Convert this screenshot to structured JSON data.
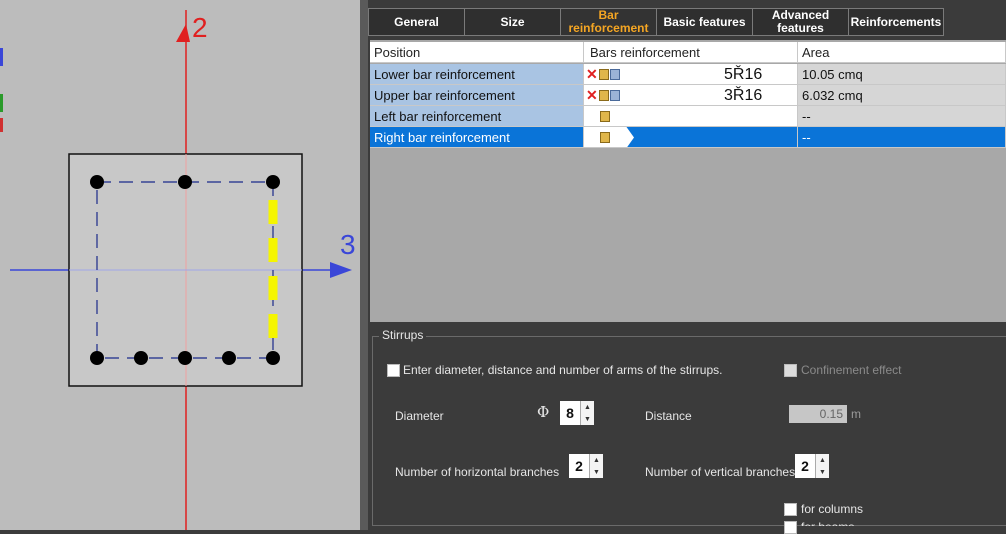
{
  "tabs": [
    {
      "label": "General",
      "active": false
    },
    {
      "label": "Size",
      "active": false
    },
    {
      "label": "Bar reinforcement",
      "active": true
    },
    {
      "label": "Basic features",
      "active": false
    },
    {
      "label": "Advanced features",
      "active": false
    },
    {
      "label": "Reinforcements",
      "active": false
    }
  ],
  "section_view": {
    "axis_vertical_label": "2",
    "axis_horizontal_label": "3",
    "colors": {
      "axis_vertical": "#e02020",
      "axis_horizontal": "#3a46d8",
      "highlight_bars": "#f5f500",
      "section_fill": "#c8c8c8"
    }
  },
  "grid": {
    "headers": {
      "position": "Position",
      "bars": "Bars reinforcement",
      "area": "Area"
    },
    "rows": [
      {
        "position": "Lower bar reinforcement",
        "bars": "5Ř16",
        "area": "10.05 cmq"
      },
      {
        "position": "Upper bar reinforcement",
        "bars": "3Ř16",
        "area": "6.032 cmq"
      },
      {
        "position": "Left bar reinforcement",
        "bars": "",
        "area": "--"
      },
      {
        "position": "Right bar reinforcement",
        "bars": "",
        "area": "--",
        "selected": true
      }
    ]
  },
  "stirrups": {
    "legend": "Stirrups",
    "enter_checkbox_label": "Enter diameter, distance and number of arms of the stirrups.",
    "confinement_label": "Confinement effect",
    "diameter_label": "Diameter",
    "diameter_symbol": "Φ",
    "diameter_value": "8",
    "distance_label": "Distance",
    "distance_value": "0.15",
    "distance_unit": "m",
    "horizontal_branches_label": "Number of horizontal branches",
    "horizontal_branches_value": "2",
    "vertical_branches_label": "Number of vertical branches",
    "vertical_branches_value": "2",
    "for_columns_label": "for columns",
    "for_beams_label": "for beams"
  }
}
